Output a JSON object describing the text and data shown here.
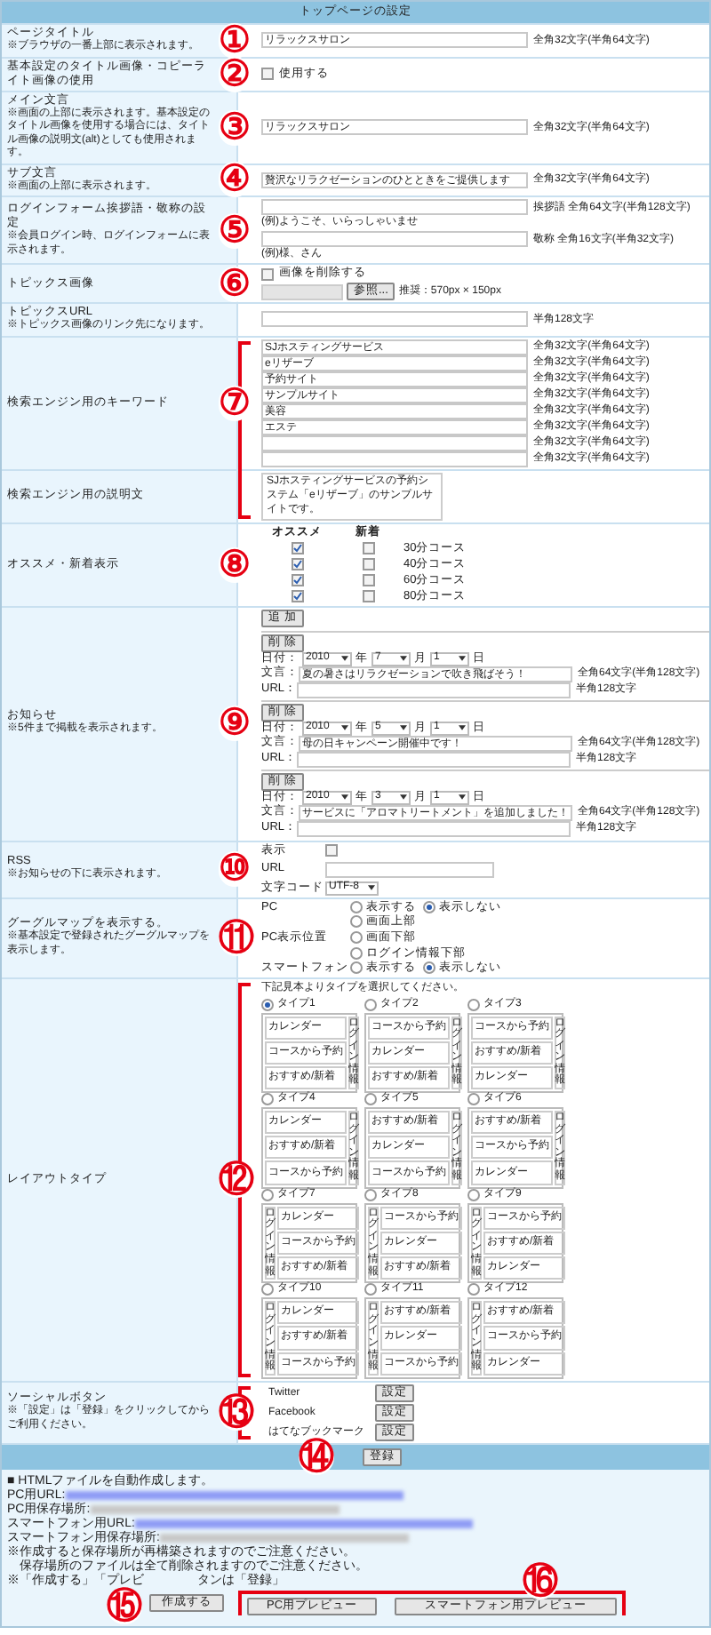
{
  "header": {
    "title": "トップページの設定"
  },
  "rows": [
    {
      "kind": "text",
      "label": "ページタイトル",
      "note": "※ブラウザの一番上部に表示されます。",
      "value": "リラックスサロン",
      "limit": "全角32文字(半角64文字)",
      "marker": "①"
    },
    {
      "kind": "checkbox",
      "label": "基本設定のタイトル画像・コピーライト画像の使用",
      "option": "使用する",
      "checked": false,
      "marker": "②"
    },
    {
      "kind": "text",
      "label": "メイン文言",
      "note": "※画面の上部に表示されます。基本設定のタイトル画像を使用する場合には、タイトル画像の説明文(alt)としても使用されます。",
      "value": "リラックスサロン",
      "limit": "全角32文字(半角64文字)",
      "marker": "③"
    },
    {
      "kind": "text",
      "label": "サブ文言",
      "note": "※画面の上部に表示されます。",
      "value": "贅沢なリラクゼーションのひとときをご提供します",
      "limit": "全角32文字(半角64文字)",
      "marker": "④"
    },
    {
      "kind": "login",
      "label": "ログインフォーム挨拶語・敬称の設定",
      "note": "※会員ログイン時、ログインフォームに表示されます。",
      "marker": "⑤",
      "fields": [
        {
          "limit": "挨拶語 全角64文字(半角128文字)",
          "example": "(例)ようこそ、いらっしゃいませ"
        },
        {
          "limit": "敬称 全角16文字(半角32文字)",
          "example": "(例)様、さん"
        }
      ]
    },
    {
      "kind": "image",
      "label": "トピックス画像",
      "option": "画像を削除する",
      "checked": false,
      "browse": "参照...",
      "hint": "推奨：570px × 150px",
      "marker": "⑥"
    },
    {
      "kind": "text",
      "label": "トピックスURL",
      "note": "※トピックス画像のリンク先になります。",
      "limit": "半角128文字"
    },
    {
      "kind": "keywords",
      "label": "検索エンジン用のキーワード",
      "marker": "⑦",
      "bracket_top": true,
      "bracket_bottom": false,
      "fields": [
        {
          "value": "SJホスティングサービス",
          "limit": "全角32文字(半角64文字)"
        },
        {
          "value": "eリザーブ",
          "limit": "全角32文字(半角64文字)"
        },
        {
          "value": "予約サイト",
          "limit": "全角32文字(半角64文字)"
        },
        {
          "value": "サンプルサイト",
          "limit": "全角32文字(半角64文字)"
        },
        {
          "value": "美容",
          "limit": "全角32文字(半角64文字)"
        },
        {
          "value": "エステ",
          "limit": "全角32文字(半角64文字)"
        },
        {
          "limit": "全角32文字(半角64文字)"
        },
        {
          "limit": "全角32文字(半角64文字)"
        }
      ]
    },
    {
      "kind": "textarea",
      "label": "検索エンジン用の説明文",
      "bracket_top": false,
      "bracket_bottom": true,
      "value": "SJホスティングサービスの予約システム「eリザーブ」のサンプルサイトです。"
    },
    {
      "kind": "recommend",
      "label": "オススメ・新着表示",
      "marker": "⑧",
      "columns": [
        "オススメ",
        "新着"
      ],
      "items": [
        {
          "course": "30分コース",
          "recommend": true,
          "new": false
        },
        {
          "course": "40分コース",
          "recommend": true,
          "new": false
        },
        {
          "course": "60分コース",
          "recommend": true,
          "new": false
        },
        {
          "course": "80分コース",
          "recommend": true,
          "new": false
        }
      ]
    },
    {
      "kind": "news",
      "label": "お知らせ",
      "note": "※5件まで掲載を表示されます。",
      "marker": "⑨",
      "add": "追 加",
      "entries": [
        {
          "delete": "削 除",
          "date_label": "日付：",
          "year": "2010",
          "year_unit": "年",
          "month": "7",
          "month_unit": "月",
          "day": "1",
          "day_unit": "日",
          "text_label": "文言：",
          "text": "夏の暑さはリラクゼーションで吹き飛ばそう！",
          "limit": "全角64文字(半角128文字)",
          "url_label": "URL：",
          "url_limit": "半角128文字"
        },
        {
          "delete": "削 除",
          "date_label": "日付：",
          "year": "2010",
          "year_unit": "年",
          "month": "5",
          "month_unit": "月",
          "day": "1",
          "day_unit": "日",
          "text_label": "文言：",
          "text": "母の日キャンペーン開催中です！",
          "limit": "全角64文字(半角128文字)",
          "url_label": "URL：",
          "url_limit": "半角128文字"
        },
        {
          "delete": "削 除",
          "date_label": "日付：",
          "year": "2010",
          "year_unit": "年",
          "month": "3",
          "month_unit": "月",
          "day": "1",
          "day_unit": "日",
          "text_label": "文言：",
          "text": "サービスに「アロマトリートメント」を追加しました！",
          "limit": "全角64文字(半角128文字)",
          "url_label": "URL：",
          "url_limit": "半角128文字"
        }
      ]
    },
    {
      "kind": "rss",
      "label": "RSS",
      "note": "※お知らせの下に表示されます。",
      "marker": "⑩",
      "show_label": "表示",
      "checked": false,
      "url_label": "URL",
      "charset_label": "文字コード",
      "charset": "UTF-8"
    },
    {
      "kind": "map",
      "label": "グーグルマップを表示する。",
      "note": "※基本設定で登録されたグーグルマップを表示します。",
      "marker": "⑪",
      "groups": [
        {
          "label": "PC",
          "stacked": false,
          "options": [
            {
              "label": "表示する",
              "selected": false
            },
            {
              "label": "表示しない",
              "selected": true
            }
          ]
        },
        {
          "label": "PC表示位置",
          "stacked": true,
          "options": [
            {
              "label": "画面上部",
              "selected": false
            },
            {
              "label": "画面下部",
              "selected": false
            },
            {
              "label": "ログイン情報下部",
              "selected": false
            }
          ]
        },
        {
          "label": "スマートフォン",
          "stacked": false,
          "options": [
            {
              "label": "表示する",
              "selected": false
            },
            {
              "label": "表示しない",
              "selected": true
            }
          ]
        }
      ]
    },
    {
      "kind": "layout",
      "label": "レイアウトタイプ",
      "marker": "⑫",
      "bracket_top": true,
      "bracket_bottom": true,
      "instruction": "下記見本よりタイプを選択してください。",
      "types": [
        {
          "name": "タイプ1",
          "selected": true,
          "login_left": false,
          "login": "ログイン情報",
          "cells": [
            "カレンダー",
            "コースから予約",
            "おすすめ/新着"
          ]
        },
        {
          "name": "タイプ2",
          "selected": false,
          "login_left": false,
          "login": "ログイン情報",
          "cells": [
            "コースから予約",
            "カレンダー",
            "おすすめ/新着"
          ]
        },
        {
          "name": "タイプ3",
          "selected": false,
          "login_left": false,
          "login": "ログイン情報",
          "cells": [
            "コースから予約",
            "おすすめ/新着",
            "カレンダー"
          ]
        },
        {
          "name": "タイプ4",
          "selected": false,
          "login_left": false,
          "login": "ログイン情報",
          "cells": [
            "カレンダー",
            "おすすめ/新着",
            "コースから予約"
          ]
        },
        {
          "name": "タイプ5",
          "selected": false,
          "login_left": false,
          "login": "ログイン情報",
          "cells": [
            "おすすめ/新着",
            "カレンダー",
            "コースから予約"
          ]
        },
        {
          "name": "タイプ6",
          "selected": false,
          "login_left": false,
          "login": "ログイン情報",
          "cells": [
            "おすすめ/新着",
            "コースから予約",
            "カレンダー"
          ]
        },
        {
          "name": "タイプ7",
          "selected": false,
          "login_left": true,
          "login": "ログイン情報",
          "cells": [
            "カレンダー",
            "コースから予約",
            "おすすめ/新着"
          ]
        },
        {
          "name": "タイプ8",
          "selected": false,
          "login_left": true,
          "login": "ログイン情報",
          "cells": [
            "コースから予約",
            "カレンダー",
            "おすすめ/新着"
          ]
        },
        {
          "name": "タイプ9",
          "selected": false,
          "login_left": true,
          "login": "ログイン情報",
          "cells": [
            "コースから予約",
            "おすすめ/新着",
            "カレンダー"
          ]
        },
        {
          "name": "タイプ10",
          "selected": false,
          "login_left": true,
          "login": "ログイン情報",
          "cells": [
            "カレンダー",
            "おすすめ/新着",
            "コースから予約"
          ]
        },
        {
          "name": "タイプ11",
          "selected": false,
          "login_left": true,
          "login": "ログイン情報",
          "cells": [
            "おすすめ/新着",
            "カレンダー",
            "コースから予約"
          ]
        },
        {
          "name": "タイプ12",
          "selected": false,
          "login_left": true,
          "login": "ログイン情報",
          "cells": [
            "おすすめ/新着",
            "コースから予約",
            "カレンダー"
          ]
        }
      ]
    },
    {
      "kind": "social",
      "label": "ソーシャルボタン",
      "note": "※「設定」は「登録」をクリックしてからご利用ください。",
      "marker": "⑬",
      "bracket_top": true,
      "bracket_bottom": true,
      "items": [
        {
          "name": "Twitter",
          "button": "設定"
        },
        {
          "name": "Facebook",
          "button": "設定"
        },
        {
          "name": "はてなブックマーク",
          "button": "設定"
        }
      ]
    }
  ],
  "register": {
    "button": "登録",
    "marker": "⑭"
  },
  "info": {
    "heading": "■ HTMLファイルを自動作成します。",
    "lines": [
      {
        "label": "PC用URL:",
        "kind": "link"
      },
      {
        "label": "PC用保存場所:",
        "kind": "path"
      },
      {
        "label": "スマートフォン用URL:",
        "kind": "link"
      },
      {
        "label": "スマートフォン用保存場所:",
        "kind": "path"
      }
    ],
    "notes": [
      "※作成すると保存場所が再構築されますのでご注意ください。",
      "　保存場所のファイルは全て削除されますのでご注意ください。"
    ],
    "last_note": [
      "※「作成する」「プレビ",
      "タンは「登録」"
    ],
    "create": {
      "label": "作成する",
      "marker": "⑮"
    },
    "previews": {
      "marker": "⑯",
      "buttons": [
        "PC用プレビュー",
        "スマートフォン用プレビュー"
      ]
    }
  }
}
